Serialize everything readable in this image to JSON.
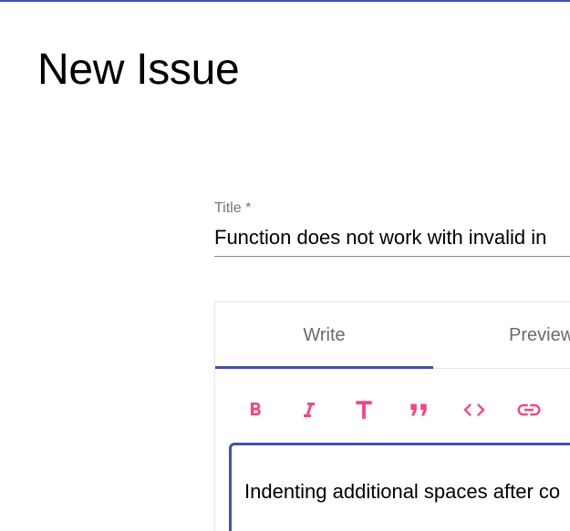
{
  "header": {
    "title": "New Issue",
    "accent_color": "#3f51b5"
  },
  "form": {
    "title_label": "Title *",
    "title_value": "Function does not work with invalid in"
  },
  "editor": {
    "tabs": [
      {
        "label": "Write",
        "active": true
      },
      {
        "label": "Preview",
        "active": false
      }
    ],
    "toolbar": [
      {
        "icon": "bold-icon"
      },
      {
        "icon": "italic-icon"
      },
      {
        "icon": "heading-icon"
      },
      {
        "icon": "quote-icon"
      },
      {
        "icon": "code-icon"
      },
      {
        "icon": "link-icon"
      },
      {
        "icon": "more-icon"
      }
    ],
    "toolbar_color": "#ff4081",
    "body_text": "Indenting additional spaces after co"
  }
}
